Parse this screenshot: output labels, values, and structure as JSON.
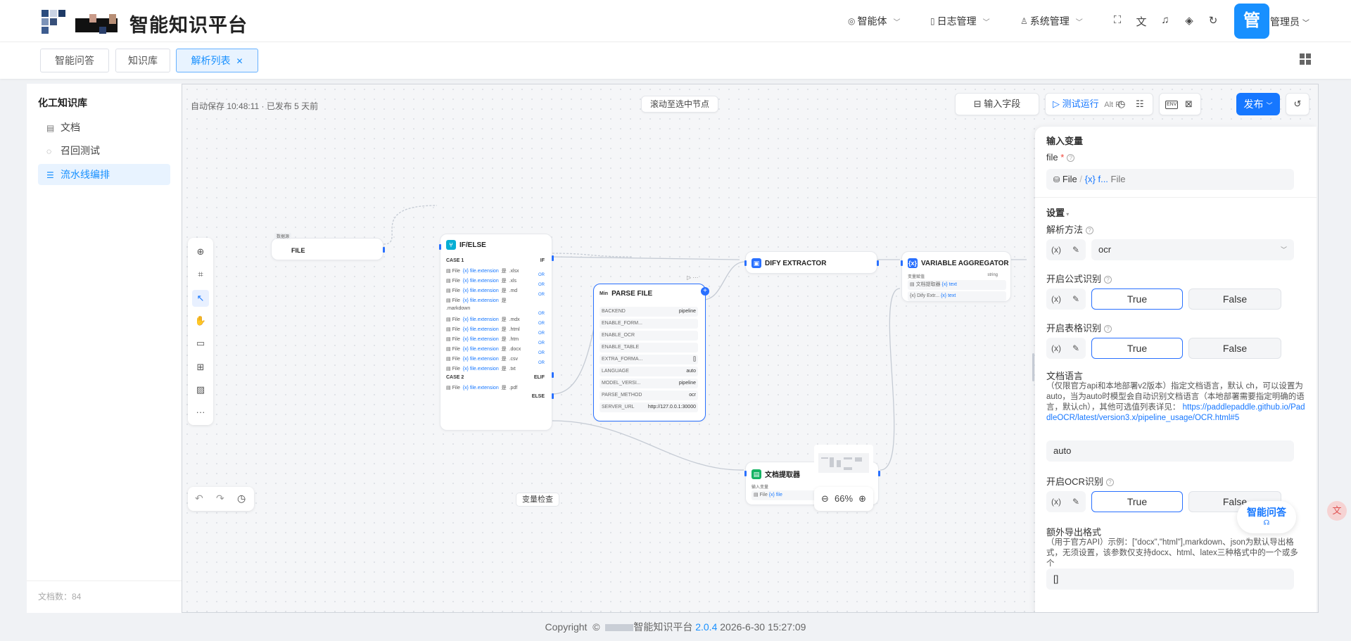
{
  "header": {
    "brand": "智能知识平台",
    "nav": [
      {
        "label": "智能体",
        "icon": "bot-icon"
      },
      {
        "label": "日志管理",
        "icon": "log-icon"
      },
      {
        "label": "系统管理",
        "icon": "user-icon"
      }
    ],
    "avatar_text": "管",
    "user_name": "管理员"
  },
  "tabs": [
    {
      "label": "智能问答"
    },
    {
      "label": "知识库"
    },
    {
      "label": "解析列表"
    }
  ],
  "sidebar": {
    "title": "化工知识库",
    "items": [
      {
        "label": "文档",
        "icon": "document-icon"
      },
      {
        "label": "召回测试",
        "icon": "target-icon"
      },
      {
        "label": "流水线编排",
        "icon": "pipeline-icon"
      }
    ],
    "doc_count": "文档数：84"
  },
  "canvas": {
    "autosave": "自动保存 10:48:11 · 已发布 5 天前",
    "scroll_to_node": "滚动至选中节点",
    "input_field_btn": "输入字段",
    "test_run_btn": "测试运行",
    "test_run_shortcut": "Alt  R",
    "env_btn": "ENV",
    "publish_btn": "发布",
    "var_check": "变量检查",
    "zoom": "66%"
  },
  "nodes": {
    "source": {
      "badge": "数据源",
      "title": "FILE"
    },
    "ifelse": {
      "title": "IF/ELSE",
      "case1": "CASE 1",
      "if_label": "IF",
      "conditions": [
        {
          "file": "File",
          "var": "{x} file.extension",
          "op": "是",
          "val": ".xlsx"
        },
        {
          "file": "File",
          "var": "{x} file.extension",
          "op": "是",
          "val": ".xls"
        },
        {
          "file": "File",
          "var": "{x} file.extension",
          "op": "是",
          "val": ".md"
        },
        {
          "file": "File",
          "var": "{x} file.extension",
          "op": "是",
          "val": ".markdown"
        },
        {
          "file": "File",
          "var": "{x} file.extension",
          "op": "是",
          "val": ".mdx"
        },
        {
          "file": "File",
          "var": "{x} file.extension",
          "op": "是",
          "val": ".html"
        },
        {
          "file": "File",
          "var": "{x} file.extension",
          "op": "是",
          "val": ".htm"
        },
        {
          "file": "File",
          "var": "{x} file.extension",
          "op": "是",
          "val": ".docx"
        },
        {
          "file": "File",
          "var": "{x} file.extension",
          "op": "是",
          "val": ".csv"
        },
        {
          "file": "File",
          "var": "{x} file.extension",
          "op": "是",
          "val": ".txt"
        }
      ],
      "or_label": "OR",
      "case2": "CASE 2",
      "elif_label": "ELIF",
      "case2_condition": {
        "file": "File",
        "var": "{x} file.extension",
        "op": "是",
        "val": ".pdf"
      },
      "else_label": "ELSE"
    },
    "parse": {
      "title": "PARSE FILE",
      "icon_text": "Min",
      "rows": [
        {
          "k": "BACKEND",
          "v": "pipeline"
        },
        {
          "k": "ENABLE_FORM...",
          "v": ""
        },
        {
          "k": "ENABLE_OCR",
          "v": ""
        },
        {
          "k": "ENABLE_TABLE",
          "v": ""
        },
        {
          "k": "EXTRA_FORMA...",
          "v": "[]"
        },
        {
          "k": "LANGUAGE",
          "v": "auto"
        },
        {
          "k": "MODEL_VERSI...",
          "v": "pipeline"
        },
        {
          "k": "PARSE_METHOD",
          "v": "ocr"
        },
        {
          "k": "SERVER_URL",
          "v": "http://127.0.0.1:30000"
        }
      ]
    },
    "extractor": {
      "title": "DIFY EXTRACTOR"
    },
    "aggregator": {
      "title": "VARIABLE AGGREGATOR",
      "sub_label": "变量赋值",
      "type_label": "string",
      "rows": [
        {
          "a": "文档提取器",
          "b": "{x} text"
        },
        {
          "a": "{x} Dify Extr...",
          "b": "{x} text"
        }
      ]
    },
    "doc_extractor": {
      "title": "文档提取器",
      "sub_label": "输入变量",
      "row_file": "File",
      "row_var": "{x} file"
    }
  },
  "panel": {
    "input_vars_title": "输入变量",
    "file_label": "file",
    "file_value": "File",
    "file_value_var": "{x} f...",
    "file_value_type": "File",
    "settings_title": "设置",
    "parse_method_label": "解析方法",
    "parse_method_value": "ocr",
    "formula_label": "开启公式识别",
    "table_label": "开启表格识别",
    "ocr_label": "开启OCR识别",
    "true_label": "True",
    "false_label": "False",
    "var_btn": "(x)",
    "lang_label": "文档语言",
    "lang_desc": "（仅限官方api和本地部署v2版本）指定文档语言，默认 ch，可以设置为auto，当为auto时模型会自动识别文档语言（本地部署需要指定明确的语言，默认ch），其他可选值列表详见：",
    "lang_link": "https://paddlepaddle.github.io/PaddleOCR/latest/version3.x/pipeline_usage/OCR.html#5",
    "lang_value": "auto",
    "extra_label": "额外导出格式",
    "extra_desc": "（用于官方API）示例：[\"docx\",\"html\"],markdown、json为默认导出格式，无须设置，该参数仅支持docx、html、latex三种格式中的一个或多个",
    "extra_value": "[]"
  },
  "float": {
    "chat_label": "智能问答"
  },
  "footer": {
    "copyright": "Copyright",
    "brand": "智能知识平台",
    "version": "2.0.4",
    "datetime": "2026-6-30 15:27:09"
  }
}
